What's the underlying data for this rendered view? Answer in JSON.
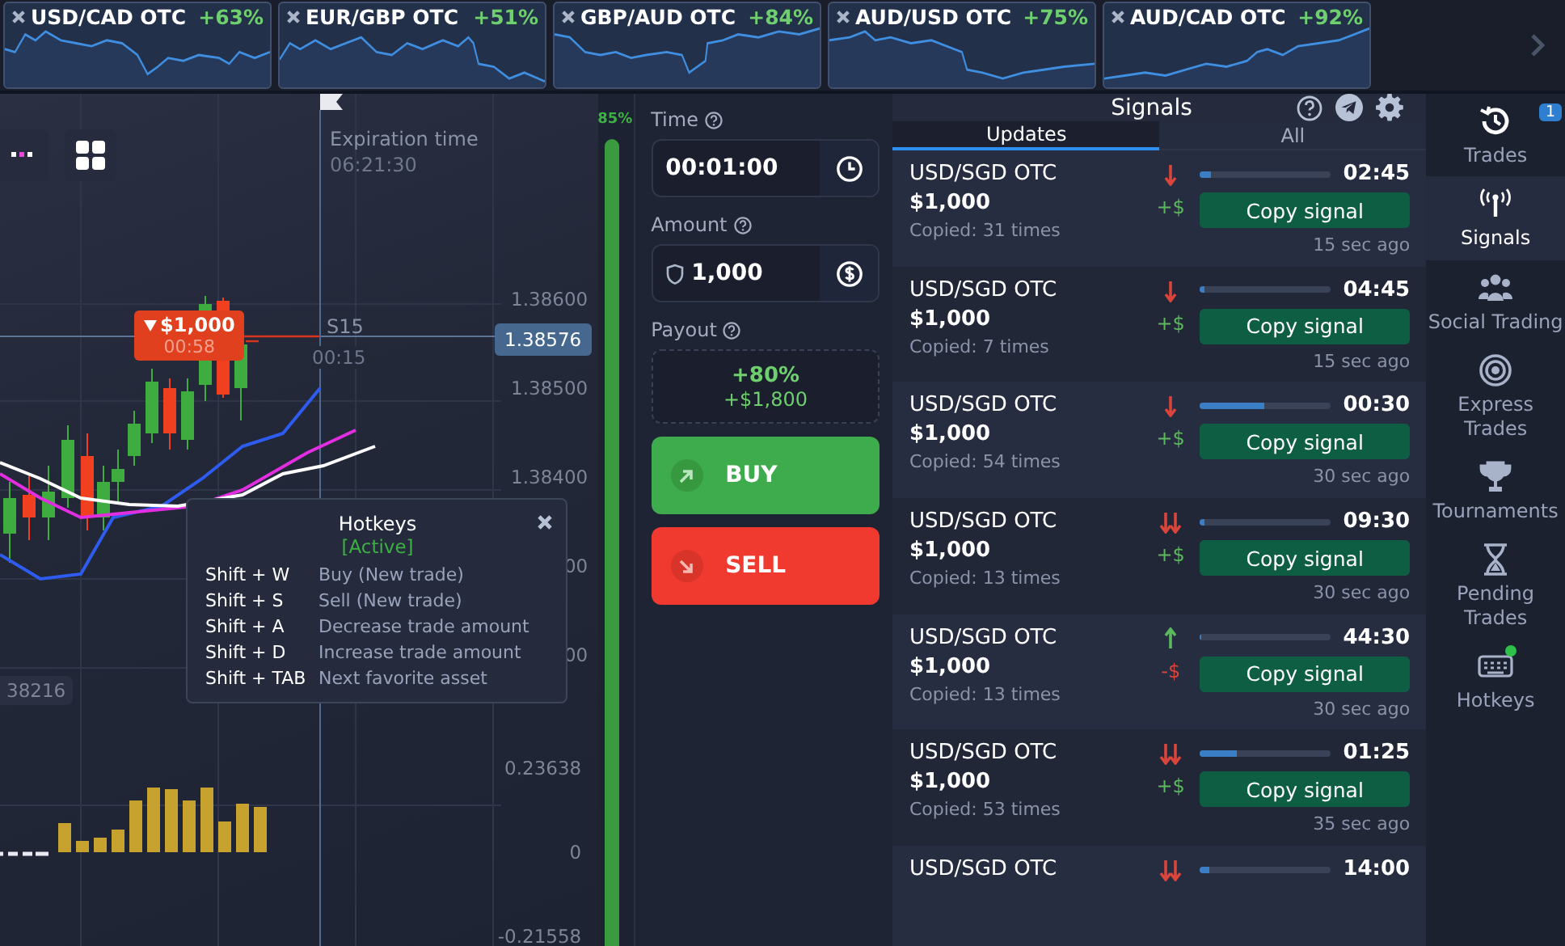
{
  "assets": [
    {
      "name": "USD/CAD OTC",
      "payout": "+63%"
    },
    {
      "name": "EUR/GBP OTC",
      "payout": "+51%"
    },
    {
      "name": "GBP/AUD OTC",
      "payout": "+84%"
    },
    {
      "name": "AUD/USD OTC",
      "payout": "+75%"
    },
    {
      "name": "AUD/CAD OTC",
      "payout": "+92%"
    }
  ],
  "chart": {
    "expiration_label": "Expiration time",
    "expiration_time": "06:21:30",
    "order": {
      "amount": "$1,000",
      "timer": "00:58"
    },
    "timeframe": "S15",
    "countdown": "00:15",
    "current_price": "1.38576",
    "price_labels": [
      "1.38600",
      "1.38500",
      "1.38400",
      "00",
      "00"
    ],
    "left_label": "38216",
    "indicator_labels": [
      "0.23638",
      "0",
      "-0.21558"
    ]
  },
  "sentiment": {
    "reading": "85%"
  },
  "trade": {
    "time_label": "Time",
    "time_value": "00:01:00",
    "amount_label": "Amount",
    "amount_value": "1,000",
    "payout_label": "Payout",
    "payout_percent": "+80%",
    "payout_amount": "+$1,800",
    "buy": "BUY",
    "sell": "SELL"
  },
  "hotkeys": {
    "title": "Hotkeys",
    "status": "[Active]",
    "rows": [
      {
        "keys": "Shift + W",
        "action": "Buy (New trade)"
      },
      {
        "keys": "Shift + S",
        "action": "Sell (New trade)"
      },
      {
        "keys": "Shift + A",
        "action": "Decrease trade amount"
      },
      {
        "keys": "Shift + D",
        "action": "Increase trade amount"
      },
      {
        "keys": "Shift + TAB",
        "action": "Next favorite asset"
      }
    ]
  },
  "signals": {
    "title": "Signals",
    "tabs": [
      {
        "label": "Updates",
        "selected": true
      },
      {
        "label": "All",
        "selected": false
      }
    ],
    "rows": [
      {
        "asset": "USD/SGD OTC",
        "amount": "$1,000",
        "copied": "Copied: 31 times",
        "kind": "down",
        "profit": "+$",
        "positive": true,
        "level": 0.08,
        "time": "02:45",
        "button": "Copy signal",
        "ago": "15 sec ago"
      },
      {
        "asset": "USD/SGD OTC",
        "amount": "$1,000",
        "copied": "Copied: 7 times",
        "kind": "down",
        "profit": "+$",
        "positive": true,
        "level": 0.04,
        "time": "04:45",
        "button": "Copy signal",
        "ago": "15 sec ago"
      },
      {
        "asset": "USD/SGD OTC",
        "amount": "$1,000",
        "copied": "Copied: 54 times",
        "kind": "down",
        "profit": "+$",
        "positive": true,
        "level": 0.5,
        "time": "00:30",
        "button": "Copy signal",
        "ago": "30 sec ago"
      },
      {
        "asset": "USD/SGD OTC",
        "amount": "$1,000",
        "copied": "Copied: 13 times",
        "kind": "strong_down",
        "profit": "+$",
        "positive": true,
        "level": 0.04,
        "time": "09:30",
        "button": "Copy signal",
        "ago": "30 sec ago"
      },
      {
        "asset": "USD/SGD OTC",
        "amount": "$1,000",
        "copied": "Copied: 13 times",
        "kind": "up",
        "profit": "-$",
        "positive": false,
        "level": 0.01,
        "time": "44:30",
        "button": "Copy signal",
        "ago": "30 sec ago"
      },
      {
        "asset": "USD/SGD OTC",
        "amount": "$1,000",
        "copied": "Copied: 53 times",
        "kind": "strong_down",
        "profit": "+$",
        "positive": true,
        "level": 0.28,
        "time": "01:25",
        "button": "Copy signal",
        "ago": "35 sec ago"
      },
      {
        "asset": "USD/SGD OTC",
        "kind": "strong_down",
        "level": 0.07,
        "time": "14:00"
      }
    ]
  },
  "sidebar": {
    "items": [
      {
        "label": "Trades",
        "selected": false,
        "badge": "1"
      },
      {
        "label": "Signals",
        "selected": true
      },
      {
        "label": "Social Trading",
        "selected": false
      },
      {
        "label": "Express Trades",
        "selected": false
      },
      {
        "label": "Tournaments",
        "selected": false
      },
      {
        "label": "Pending Trades",
        "selected": false
      },
      {
        "label": "Hotkeys",
        "selected": false,
        "online": true
      }
    ]
  }
}
